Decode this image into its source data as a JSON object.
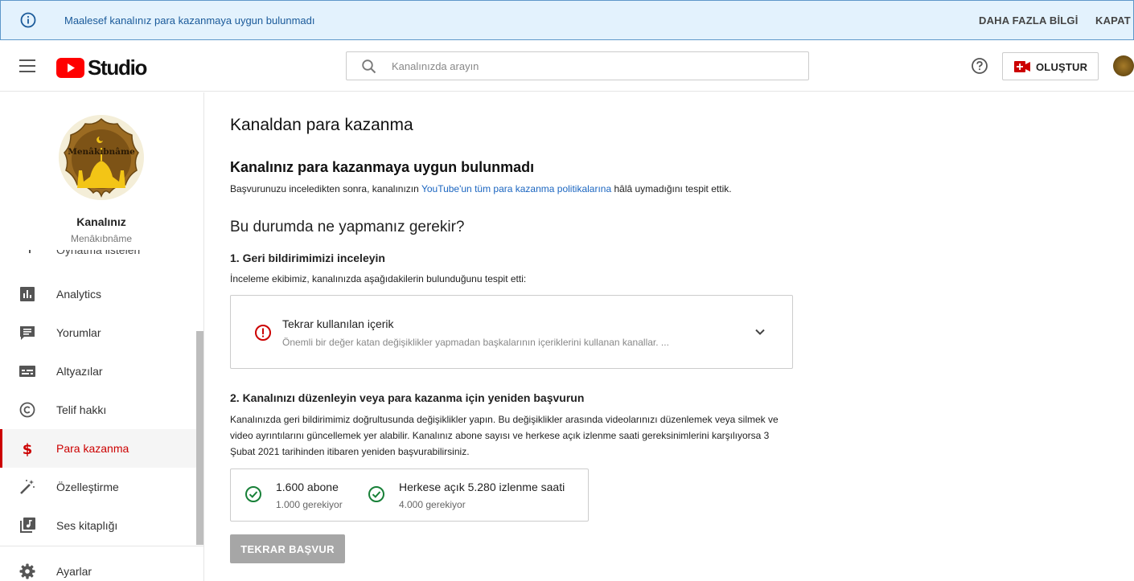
{
  "banner": {
    "message": "Maalesef kanalınız para kazanmaya uygun bulunmadı",
    "more_label": "DAHA FAZLA BİLGİ",
    "close_label": "KAPAT",
    "icon": "info-icon",
    "bg_color": "#e3f2fd"
  },
  "header": {
    "logo_text": "Studio",
    "search_placeholder": "Kanalınızda arayın",
    "create_label": "OLUŞTUR",
    "icons": [
      "menu-icon",
      "youtube-logo-icon",
      "search-icon",
      "help-icon",
      "create-video-icon",
      "avatar"
    ]
  },
  "sidebar": {
    "channel_title": "Kanalınız",
    "channel_name": "Menâkıbnâme",
    "avatar_text": "Menâkıbnâme",
    "cut_item": "Oynatma listeleri",
    "items": [
      {
        "label": "Analytics",
        "icon": "analytics-icon"
      },
      {
        "label": "Yorumlar",
        "icon": "comments-icon"
      },
      {
        "label": "Altyazılar",
        "icon": "subtitles-icon"
      },
      {
        "label": "Telif hakkı",
        "icon": "copyright-icon"
      },
      {
        "label": "Para kazanma",
        "icon": "dollar-icon",
        "active": true
      },
      {
        "label": "Özelleştirme",
        "icon": "magic-wand-icon"
      },
      {
        "label": "Ses kitaplığı",
        "icon": "audio-library-icon"
      }
    ],
    "settings_label": "Ayarlar",
    "accent_color": "#cc0000"
  },
  "main": {
    "page_title": "Kanaldan para kazanma",
    "heading": "Kanalınız para kazanmaya uygun bulunmadı",
    "intro_pre": "Başvurunuzu inceledikten sonra, kanalınızın ",
    "intro_link": "YouTube'un tüm para kazanma politikalarına",
    "intro_post": " hâlâ uymadığını tespit ettik.",
    "what_to_do": "Bu durumda ne yapmanız gerekir?",
    "step1_title": "1. Geri bildirimimizi inceleyin",
    "step1_desc": "İnceleme ekibimiz, kanalınızda aşağıdakilerin bulunduğunu tespit etti:",
    "issue_title": "Tekrar kullanılan içerik",
    "issue_desc": "Önemli bir değer katan değişiklikler yapmadan başkalarının içeriklerini kullanan kanallar. ...",
    "step2_title": "2. Kanalınızı düzenleyin veya para kazanma için yeniden başvurun",
    "step2_desc": "Kanalınızda geri bildirimimiz doğrultusunda değişiklikler yapın. Bu değişiklikler arasında videolarınızı düzenlemek veya silmek ve video ayrıntılarını güncellemek yer alabilir. Kanalınız abone sayısı ve herkese açık izlenme saati gereksinimlerini karşılıyorsa 3 Şubat 2021 tarihinden itibaren yeniden başvurabilirsiniz.",
    "requirements": [
      {
        "title": "1.600 abone",
        "sub": "1.000 gerekiyor",
        "icon": "check-circle-icon"
      },
      {
        "title": "Herkese açık 5.280 izlenme saati",
        "sub": "4.000 gerekiyor",
        "icon": "check-circle-icon"
      }
    ],
    "reapply_label": "TEKRAR BAŞVUR",
    "link_color": "#1a65c0",
    "check_color": "#188038",
    "error_color": "#cc0000"
  }
}
